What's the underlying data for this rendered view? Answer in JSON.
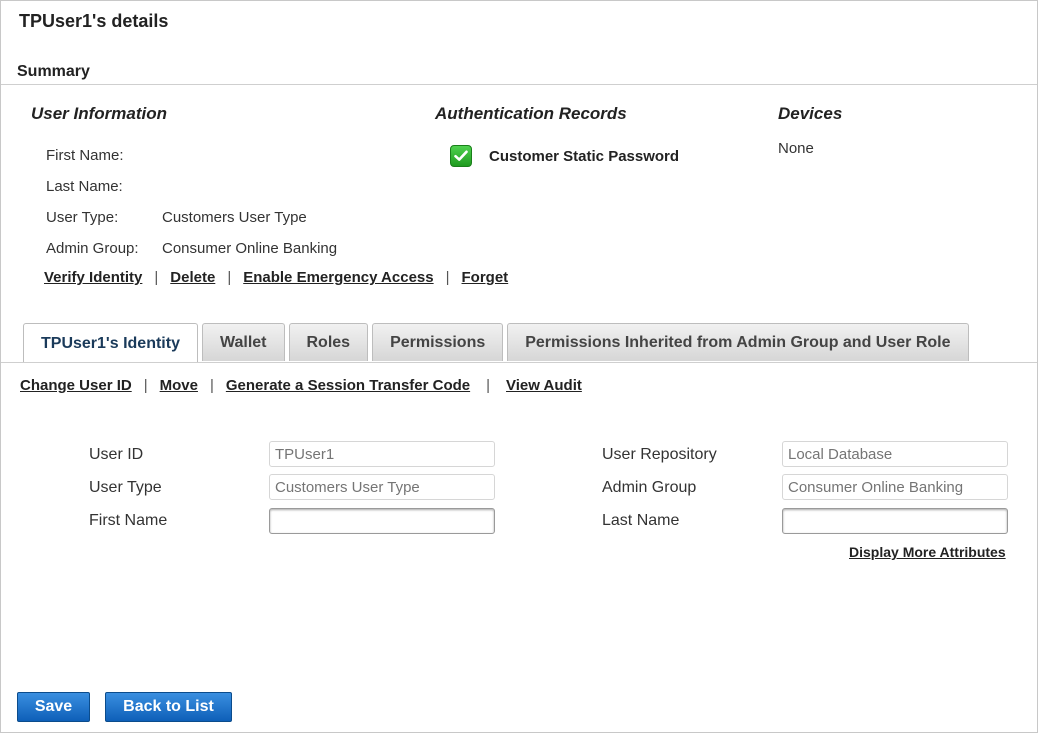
{
  "page_title": "TPUser1's details",
  "summary": {
    "title": "Summary",
    "user_information": {
      "heading": "User Information",
      "rows": [
        {
          "label": "First Name:",
          "value": ""
        },
        {
          "label": "Last Name:",
          "value": ""
        },
        {
          "label": "User Type:",
          "value": "Customers User Type"
        },
        {
          "label": "Admin Group:",
          "value": "Consumer Online Banking"
        }
      ]
    },
    "authentication_records": {
      "heading": "Authentication Records",
      "items": [
        {
          "label": "Customer Static Password",
          "icon": "check-icon",
          "color": "#2db52d"
        }
      ]
    },
    "devices": {
      "heading": "Devices",
      "value": "None"
    },
    "actions": [
      "Verify Identity",
      "Delete",
      "Enable Emergency Access",
      "Forget"
    ]
  },
  "tabs": [
    {
      "label": "TPUser1's Identity",
      "active": true
    },
    {
      "label": "Wallet",
      "active": false
    },
    {
      "label": "Roles",
      "active": false
    },
    {
      "label": "Permissions",
      "active": false
    },
    {
      "label": "Permissions Inherited from Admin Group and User Role",
      "active": false
    }
  ],
  "identity_links": [
    "Change User ID",
    "Move",
    "Generate a Session Transfer Code",
    "View Audit"
  ],
  "form": {
    "user_id": {
      "label": "User ID",
      "placeholder": "TPUser1"
    },
    "user_repository": {
      "label": "User Repository",
      "placeholder": "Local Database"
    },
    "user_type": {
      "label": "User Type",
      "placeholder": "Customers User Type"
    },
    "admin_group": {
      "label": "Admin Group",
      "placeholder": "Consumer Online Banking"
    },
    "first_name": {
      "label": "First Name",
      "value": ""
    },
    "last_name": {
      "label": "Last Name",
      "value": ""
    },
    "more_link": "Display More Attributes"
  },
  "buttons": {
    "save": "Save",
    "back": "Back to List"
  },
  "colors": {
    "button_blue": "#0e5fb8",
    "check_green": "#2db52d"
  }
}
